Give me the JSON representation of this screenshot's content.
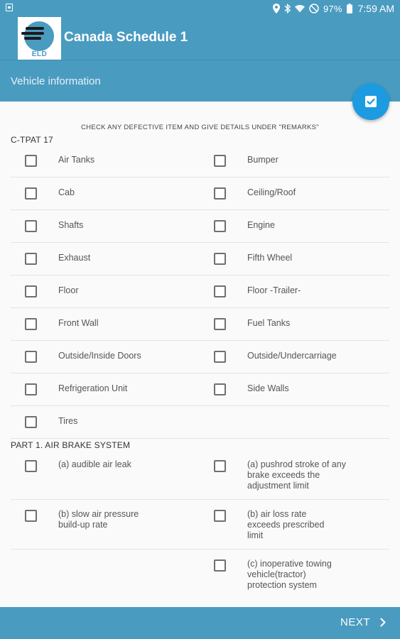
{
  "status_bar": {
    "battery": "97%",
    "time": "7:59 AM"
  },
  "app": {
    "title": "Canada Schedule 1",
    "logo_text": "ELD"
  },
  "subheader": {
    "title": "Vehicle information"
  },
  "instructions": "CHECK ANY DEFECTIVE ITEM AND GIVE DETAILS UNDER \"REMARKS\"",
  "sections": [
    {
      "title": "C-TPAT 17",
      "rows": [
        {
          "left": "Air Tanks",
          "right": "Bumper"
        },
        {
          "left": "Cab",
          "right": "Ceiling/Roof"
        },
        {
          "left": "Shafts",
          "right": "Engine"
        },
        {
          "left": "Exhaust",
          "right": "Fifth Wheel"
        },
        {
          "left": "Floor",
          "right": "Floor -Trailer-"
        },
        {
          "left": "Front Wall",
          "right": "Fuel Tanks"
        },
        {
          "left": "Outside/Inside Doors",
          "right": "Outside/Undercarriage"
        },
        {
          "left": "Refrigeration Unit",
          "right": "Side Walls"
        },
        {
          "left": "Tires",
          "right": ""
        }
      ]
    },
    {
      "title": "PART 1. AIR BRAKE SYSTEM",
      "rows": [
        {
          "left": "(a) audible air leak",
          "right": "(a) pushrod stroke of any brake exceeds the adjustment limit"
        },
        {
          "left": "(b) slow air pressure build-up rate",
          "right": "(b) air loss rate exceeds prescribed limit"
        },
        {
          "left": "",
          "right": "(c) inoperative towing vehicle(tractor) protection system"
        }
      ]
    }
  ],
  "bottom": {
    "next_label": "NEXT"
  },
  "colors": {
    "primary": "#4a9bc0",
    "fab": "#1c9be0"
  }
}
